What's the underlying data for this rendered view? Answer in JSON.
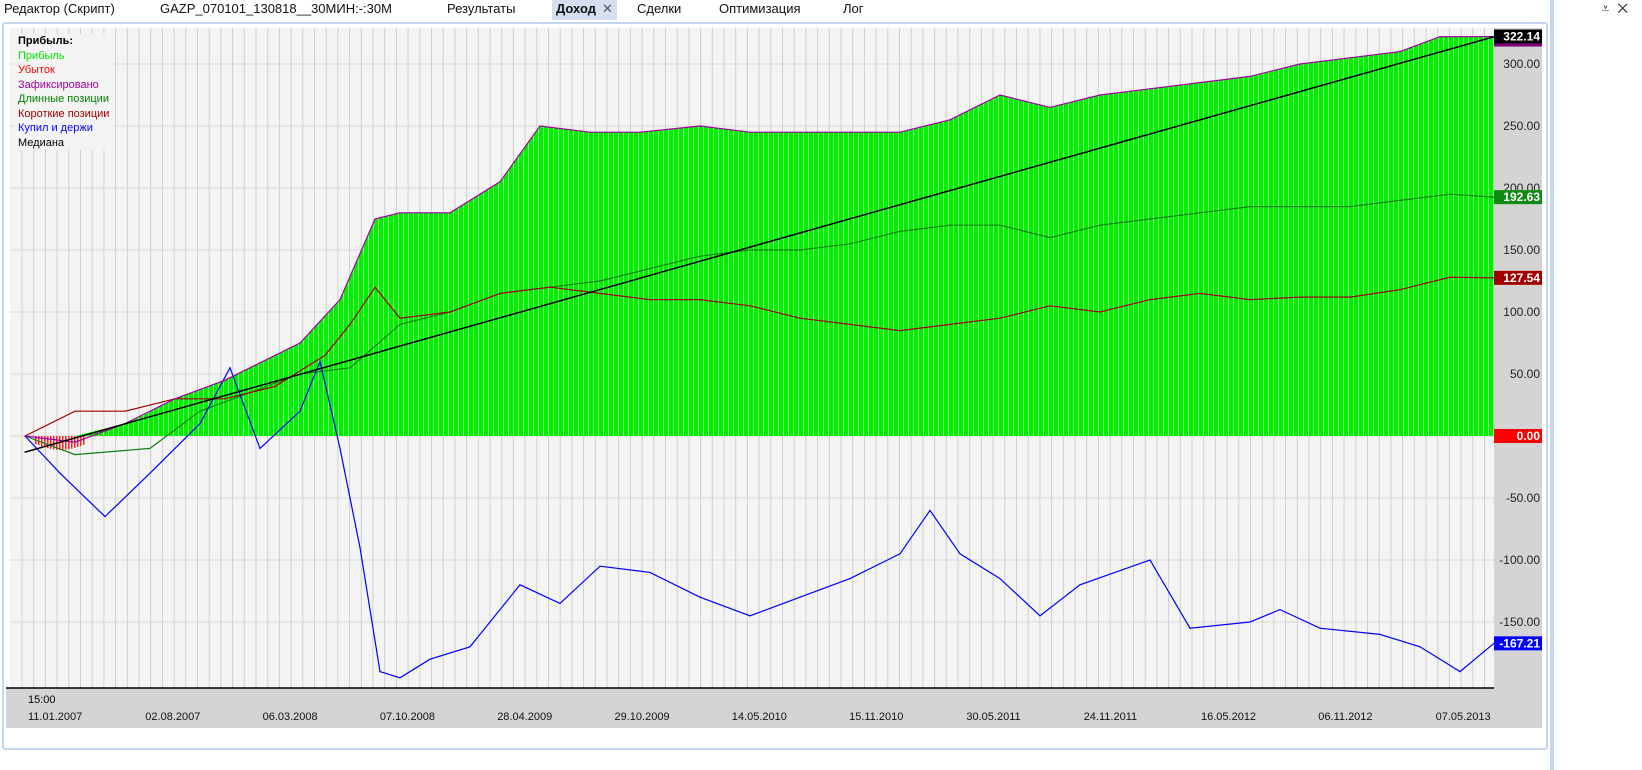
{
  "tabs": [
    {
      "label": "Редактор (Скрипт)"
    },
    {
      "label": "GAZP_070101_130818__30МИН:-:30M"
    },
    {
      "label": "Результаты"
    },
    {
      "label": "Доход",
      "active": true,
      "close": "✕"
    },
    {
      "label": "Сделки"
    },
    {
      "label": "Оптимизация"
    },
    {
      "label": "Лог"
    }
  ],
  "window_controls": {
    "menu": "⩡",
    "close": "✕"
  },
  "legend": {
    "title": "Прибыль:",
    "items": [
      {
        "label": "Прибыль",
        "color": "#00e000"
      },
      {
        "label": "Убыток",
        "color": "#ff0000"
      },
      {
        "label": "Зафиксировано",
        "color": "#a000a0"
      },
      {
        "label": "Длинные позиции",
        "color": "#008000"
      },
      {
        "label": "Короткие позиции",
        "color": "#a00000"
      },
      {
        "label": "Купил и держи",
        "color": "#0000ff"
      },
      {
        "label": "Медиана",
        "color": "#000000"
      }
    ]
  },
  "chart_data": {
    "type": "line",
    "ylim": [
      -200,
      330
    ],
    "yticks": [
      300,
      250,
      200,
      150,
      100,
      50,
      0,
      -50,
      -100,
      -150
    ],
    "ytick_labels": [
      "300.00",
      "250.00",
      "200.00",
      "150.00",
      "100.00",
      "50.00",
      "-50.00",
      "-100.00",
      "-150.00"
    ],
    "time_label": "15:00",
    "xtick_labels": [
      "11.01.2007",
      "02.08.2007",
      "06.03.2008",
      "07.10.2008",
      "28.04.2009",
      "29.10.2009",
      "14.05.2010",
      "15.11.2010",
      "30.05.2011",
      "24.11.2011",
      "16.05.2012",
      "06.11.2012",
      "07.05.2013"
    ],
    "last_values": {
      "profit": "322.14",
      "long": "192.63",
      "short": "127.54",
      "zero": "0.00",
      "buyhold": "-167.21"
    },
    "series": [
      {
        "name": "Зафиксировано",
        "key": "profit",
        "color": "#a000a0",
        "t": [
          0,
          50,
          100,
          150,
          200,
          250,
          275,
          315,
          350,
          375,
          425,
          475,
          515,
          565,
          615,
          675,
          725,
          775,
          825,
          875,
          925,
          975,
          1025,
          1075,
          1125,
          1175,
          1225,
          1275,
          1325,
          1375,
          1415,
          1469
        ],
        "values": [
          0,
          -5,
          10,
          30,
          45,
          65,
          75,
          110,
          175,
          180,
          180,
          205,
          250,
          245,
          245,
          250,
          245,
          245,
          245,
          245,
          255,
          275,
          265,
          275,
          280,
          285,
          290,
          300,
          305,
          310,
          322,
          322.14
        ]
      },
      {
        "name": "Длинные позиции",
        "key": "long",
        "color": "#108010",
        "t": [
          0,
          50,
          125,
          175,
          225,
          275,
          325,
          375,
          425,
          475,
          525,
          575,
          625,
          675,
          725,
          775,
          825,
          875,
          925,
          975,
          1025,
          1075,
          1125,
          1175,
          1225,
          1275,
          1325,
          1375,
          1425,
          1469
        ],
        "values": [
          0,
          -15,
          -10,
          20,
          35,
          50,
          55,
          90,
          100,
          115,
          120,
          125,
          135,
          145,
          150,
          150,
          155,
          165,
          170,
          170,
          160,
          170,
          175,
          180,
          185,
          185,
          185,
          190,
          195,
          192.63
        ]
      },
      {
        "name": "Короткие позиции",
        "key": "short",
        "color": "#a00000",
        "t": [
          0,
          50,
          100,
          150,
          200,
          250,
          300,
          325,
          350,
          375,
          425,
          475,
          525,
          575,
          625,
          675,
          725,
          775,
          825,
          875,
          925,
          975,
          1025,
          1075,
          1125,
          1175,
          1225,
          1275,
          1325,
          1375,
          1425,
          1469
        ],
        "values": [
          0,
          20,
          20,
          30,
          30,
          40,
          65,
          90,
          120,
          95,
          100,
          115,
          120,
          115,
          110,
          110,
          105,
          95,
          90,
          85,
          90,
          95,
          105,
          100,
          110,
          115,
          110,
          112,
          112,
          118,
          128,
          127.54
        ]
      },
      {
        "name": "Купил и держи",
        "key": "buyhold",
        "color": "#0000ff",
        "t": [
          0,
          35,
          80,
          125,
          175,
          205,
          235,
          275,
          295,
          315,
          335,
          355,
          375,
          405,
          445,
          495,
          535,
          575,
          625,
          675,
          725,
          775,
          825,
          875,
          905,
          935,
          975,
          1015,
          1055,
          1125,
          1165,
          1225,
          1255,
          1295,
          1355,
          1395,
          1435,
          1469
        ],
        "values": [
          0,
          -30,
          -65,
          -30,
          10,
          55,
          -10,
          20,
          60,
          -10,
          -90,
          -190,
          -195,
          -180,
          -170,
          -120,
          -135,
          -105,
          -110,
          -130,
          -145,
          -130,
          -115,
          -95,
          -60,
          -95,
          -115,
          -145,
          -120,
          -100,
          -155,
          -150,
          -140,
          -155,
          -160,
          -170,
          -190,
          -167.21
        ]
      },
      {
        "name": "Медиана",
        "key": "median",
        "color": "#000000",
        "t": [
          0,
          1469
        ],
        "values": [
          -13,
          322
        ]
      }
    ]
  }
}
